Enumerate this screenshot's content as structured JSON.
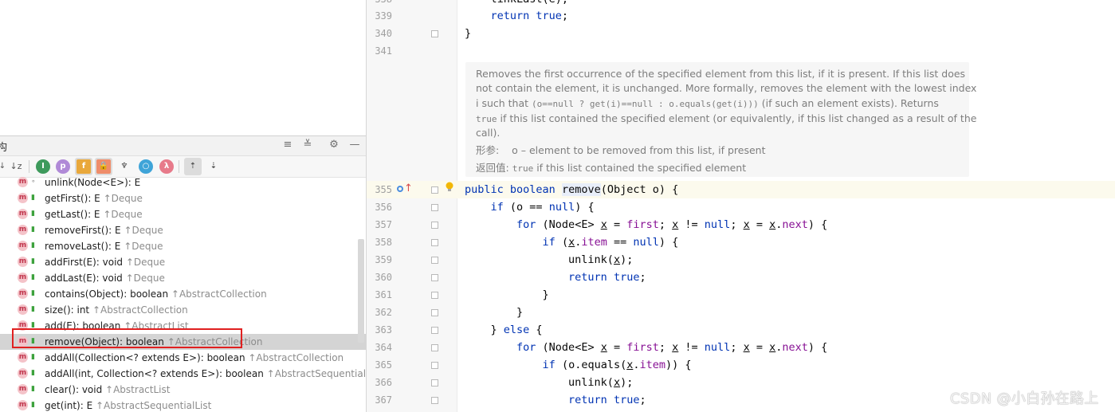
{
  "structure_panel": {
    "title": "构",
    "methods": [
      {
        "name": "unlink(Node<E>): E",
        "inherited": ""
      },
      {
        "name": "getFirst(): E",
        "inherited": "↑Deque"
      },
      {
        "name": "getLast(): E",
        "inherited": "↑Deque"
      },
      {
        "name": "removeFirst(): E",
        "inherited": "↑Deque"
      },
      {
        "name": "removeLast(): E",
        "inherited": "↑Deque"
      },
      {
        "name": "addFirst(E): void",
        "inherited": "↑Deque"
      },
      {
        "name": "addLast(E): void",
        "inherited": "↑Deque"
      },
      {
        "name": "contains(Object): boolean",
        "inherited": "↑AbstractCollection"
      },
      {
        "name": "size(): int",
        "inherited": "↑AbstractCollection"
      },
      {
        "name": "add(E): boolean",
        "inherited": "↑AbstractList"
      },
      {
        "name": "remove(Object): boolean",
        "inherited": "↑AbstractCollection"
      },
      {
        "name": "addAll(Collection<? extends E>): boolean",
        "inherited": "↑AbstractCollection"
      },
      {
        "name": "addAll(int, Collection<? extends E>): boolean",
        "inherited": "↑AbstractSequentialLi"
      },
      {
        "name": "clear(): void",
        "inherited": "↑AbstractList"
      },
      {
        "name": "get(int): E",
        "inherited": "↑AbstractSequentialList"
      }
    ],
    "selected_index": 10,
    "method_icon": "m"
  },
  "editor": {
    "top_lines": [
      {
        "num": "339",
        "code": "    return true;"
      },
      {
        "num": "340",
        "code": "}"
      },
      {
        "num": "341",
        "code": ""
      }
    ],
    "doc": {
      "line1": "Removes the first occurrence of the specified element from this list, if it is present. If this list does",
      "line2": "not contain the element, it is unchanged. More formally, removes the element with the lowest index",
      "line3_a": "i such that",
      "line3_code": "(o==null  ?  get(i)==null  :  o.equals(get(i)))",
      "line3_b": "(if such an element exists). Returns",
      "line4_code": "true",
      "line4_b": "if this list contained the specified element (or equivalently, if this list changed as a result of the",
      "line5": "call).",
      "param_label": "形参:",
      "param_text": "o – element to be removed from this list, if present",
      "return_label": "返回值:",
      "return_code": "true",
      "return_text": "if this list contained the specified element"
    },
    "line_numbers": [
      "355",
      "356",
      "357",
      "358",
      "359",
      "360",
      "361",
      "362",
      "363",
      "364",
      "365",
      "366",
      "367"
    ]
  },
  "watermark": "CSDN @小白孙在路上",
  "colors": {
    "keyword": "#0033b3",
    "field": "#871094",
    "highlight": "#e02020"
  }
}
